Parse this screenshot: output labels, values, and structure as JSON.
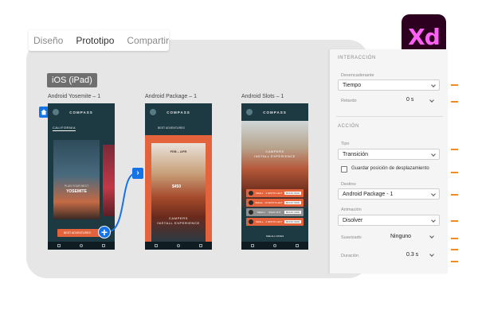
{
  "tabs": [
    {
      "label": "Diseño",
      "active": false
    },
    {
      "label": "Prototipo",
      "active": true
    },
    {
      "label": "Compartir",
      "active": false
    }
  ],
  "logo": {
    "text": "Xd",
    "bg": "#2e001f",
    "fg": "#ff61f6"
  },
  "canvas": {
    "badge": "iOS (iPad)",
    "artboards": [
      {
        "title": "Android Yosemite – 1",
        "header": "COMPASS",
        "subnav": "CALIFORNIA",
        "card_small": "PLAN YOUR NEXT",
        "card_title": "YOSEMITE",
        "cta": "BEST ADVENTURES"
      },
      {
        "title": "Android Package – 1",
        "header": "COMPASS",
        "bar": "BEST ADVENTURES",
        "dates": "FEB – APR",
        "price": "$450",
        "caption1": "CAMPERS",
        "caption2": "INSTALL EXPERIENCE"
      },
      {
        "title": "Android Slots – 1",
        "header": "COMPASS",
        "caption1": "CAMPERS",
        "caption2": "INSTALL EXPERIENCE",
        "slots": [
          {
            "left": "SMALL",
            "mid": "4 SPOTS LEFT",
            "book": "BOOK NOW"
          },
          {
            "left": "SMALL",
            "mid": "10 SPOTS LEFT",
            "book": "BOOK NOW"
          },
          {
            "left": "SMALL",
            "mid": "SOLD OUT",
            "book": "BOOK NOW"
          },
          {
            "left": "SMALL",
            "mid": "2 SPOTS LEFT",
            "book": "BOOK NOW"
          }
        ],
        "link": "SEE ALL DATES"
      }
    ]
  },
  "panel": {
    "interaction_title": "INTERACCIÓN",
    "trigger_label": "Desencadenante",
    "trigger_value": "Tiempo",
    "delay_label": "Retardo",
    "delay_value": "0 s",
    "action_title": "ACCIÓN",
    "type_label": "Tipo",
    "type_value": "Transición",
    "preserve_scroll_label": "Guardar posición de desplazamiento",
    "destination_label": "Destino",
    "destination_value": "Android Package - 1",
    "animation_label": "Animación",
    "animation_value": "Disolver",
    "easing_label": "Suavizado",
    "easing_value": "Ninguno",
    "duration_label": "Duración",
    "duration_value": "0.3 s"
  },
  "colors": {
    "accent": "#1473e6",
    "callout": "#f08a24",
    "phone_orange": "#e3643c",
    "phone_teal": "#1d3942"
  }
}
